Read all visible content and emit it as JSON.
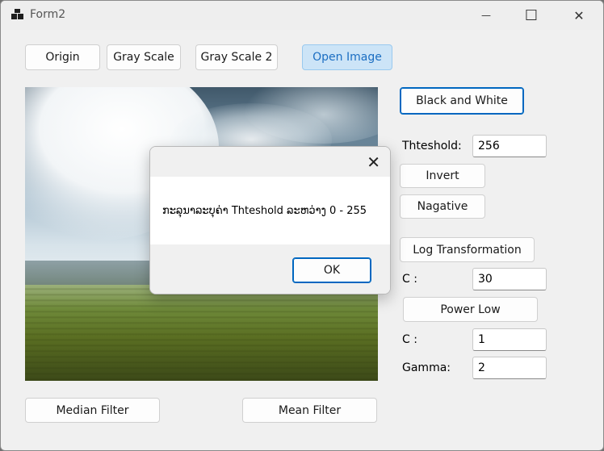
{
  "window": {
    "title": "Form2",
    "minimize_glyph": "—",
    "maximize_glyph": "☐",
    "close_glyph": "✕"
  },
  "toolbar": {
    "origin": "Origin",
    "gray_scale": "Gray Scale",
    "gray_scale_2": "Gray Scale 2",
    "open_image": "Open Image"
  },
  "right_panel": {
    "black_and_white": "Black and White",
    "threshold_label": "Thteshold:",
    "threshold_value": "256",
    "invert": "Invert",
    "negative": "Nagative",
    "log_transformation": "Log Transformation",
    "log_c_label": "C :",
    "log_c_value": "30",
    "power_low": "Power Low",
    "power_c_label": "C :",
    "power_c_value": "1",
    "gamma_label": "Gamma:",
    "gamma_value": "2"
  },
  "bottom": {
    "median_filter": "Median Filter",
    "mean_filter": "Mean Filter"
  },
  "dialog": {
    "close_glyph": "✕",
    "message": "ກະລຸນາລະບຸຄ່າ Thteshold ລະຫວ່າງ 0 - 255",
    "ok": "OK"
  },
  "image": {
    "subject": "landscape with cloudy sky and grass field"
  },
  "colors": {
    "accent": "#0067c0",
    "open_button_bg": "#cce4f7"
  }
}
